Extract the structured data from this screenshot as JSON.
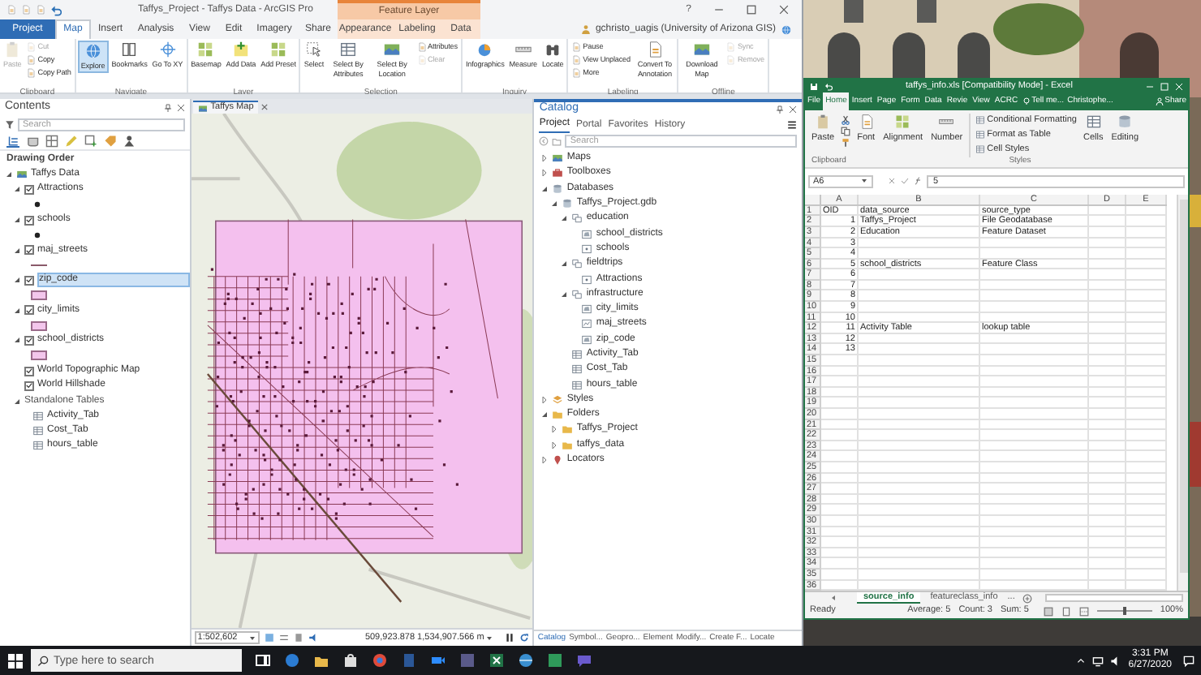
{
  "arcgis": {
    "title": "Taffys_Project - Taffys Data - ArcGIS Pro",
    "context_group": "Feature Layer",
    "help": "?",
    "tabs": [
      {
        "label": "Project",
        "kind": "backstage",
        "selected": false
      },
      {
        "label": "Map",
        "kind": "core",
        "selected": true
      },
      {
        "label": "Insert",
        "kind": "core",
        "selected": false
      },
      {
        "label": "Analysis",
        "kind": "core",
        "selected": false
      },
      {
        "label": "View",
        "kind": "core",
        "selected": false
      },
      {
        "label": "Edit",
        "kind": "core",
        "selected": false
      },
      {
        "label": "Imagery",
        "kind": "core",
        "selected": false
      },
      {
        "label": "Share",
        "kind": "core",
        "selected": false
      },
      {
        "label": "Appearance",
        "kind": "context",
        "selected": false
      },
      {
        "label": "Labeling",
        "kind": "context",
        "selected": false
      },
      {
        "label": "Data",
        "kind": "context",
        "selected": false
      }
    ],
    "user": "gchristo_uagis (University of Arizona GIS)",
    "ribbon": [
      {
        "label": "Clipboard",
        "tools": [
          {
            "label": "Paste",
            "kind": "large",
            "disabled": true,
            "selected": false
          },
          {
            "label": "Cut",
            "kind": "small",
            "disabled": true,
            "selected": false
          },
          {
            "label": "Copy",
            "kind": "small",
            "disabled": false,
            "selected": false
          },
          {
            "label": "Copy Path",
            "kind": "small",
            "disabled": false,
            "selected": false
          }
        ]
      },
      {
        "label": "Navigate",
        "tools": [
          {
            "label": "Explore",
            "kind": "large",
            "disabled": false,
            "selected": true
          },
          {
            "label": "Bookmarks",
            "kind": "large",
            "disabled": false,
            "selected": false
          },
          {
            "label": "Go To XY",
            "kind": "large",
            "disabled": false,
            "selected": false
          }
        ]
      },
      {
        "label": "Layer",
        "tools": [
          {
            "label": "Basemap",
            "kind": "large",
            "disabled": false,
            "selected": false
          },
          {
            "label": "Add Data",
            "kind": "large",
            "disabled": false,
            "selected": false
          },
          {
            "label": "Add Preset",
            "kind": "large",
            "disabled": false,
            "selected": false
          }
        ]
      },
      {
        "label": "Selection",
        "tools": [
          {
            "label": "Select",
            "kind": "large",
            "disabled": false,
            "selected": false
          },
          {
            "label": "Select By Attributes",
            "kind": "large",
            "disabled": false,
            "selected": false
          },
          {
            "label": "Select By Location",
            "kind": "large",
            "disabled": false,
            "selected": false
          },
          {
            "label": "Attributes",
            "kind": "small",
            "disabled": false,
            "selected": false
          },
          {
            "label": "Clear",
            "kind": "small",
            "disabled": true,
            "selected": false
          }
        ]
      },
      {
        "label": "Inquiry",
        "tools": [
          {
            "label": "Infographics",
            "kind": "large",
            "disabled": false,
            "selected": false
          },
          {
            "label": "Measure",
            "kind": "large",
            "disabled": false,
            "selected": false
          },
          {
            "label": "Locate",
            "kind": "large",
            "disabled": false,
            "selected": false
          }
        ]
      },
      {
        "label": "Labeling",
        "tools": [
          {
            "label": "Pause",
            "kind": "small",
            "disabled": false,
            "selected": false
          },
          {
            "label": "View Unplaced",
            "kind": "small",
            "disabled": false,
            "selected": false
          },
          {
            "label": "More",
            "kind": "small",
            "disabled": false,
            "selected": false
          },
          {
            "label": "Convert To Annotation",
            "kind": "large",
            "disabled": false,
            "selected": false
          }
        ]
      },
      {
        "label": "Offline",
        "tools": [
          {
            "label": "Download Map",
            "kind": "large",
            "disabled": false,
            "selected": false
          },
          {
            "label": "Sync",
            "kind": "small",
            "disabled": true,
            "selected": false
          },
          {
            "label": "Remove",
            "kind": "small",
            "disabled": true,
            "selected": false
          }
        ]
      }
    ],
    "contents": {
      "title": "Contents",
      "search_placeholder": "Search",
      "heading": "Drawing Order",
      "map": {
        "label": "Taffys Data",
        "expanded": true,
        "children": [
          {
            "label": "Attractions",
            "kind": "feature_layer",
            "checked": true,
            "expanded": true,
            "legend": {
              "kind": "point"
            },
            "selected": false
          },
          {
            "label": "schools",
            "kind": "feature_layer",
            "checked": true,
            "expanded": true,
            "legend": {
              "kind": "point"
            },
            "selected": false
          },
          {
            "label": "maj_streets",
            "kind": "feature_layer",
            "checked": true,
            "expanded": true,
            "legend": {
              "kind": "line"
            },
            "selected": false
          },
          {
            "label": "zip_code",
            "kind": "feature_layer",
            "checked": true,
            "expanded": true,
            "legend": {
              "kind": "polygon"
            },
            "selected": true
          },
          {
            "label": "city_limits",
            "kind": "feature_layer",
            "checked": true,
            "expanded": true,
            "legend": {
              "kind": "polygon"
            },
            "selected": false
          },
          {
            "label": "school_districts",
            "kind": "feature_layer",
            "checked": true,
            "expanded": true,
            "legend": {
              "kind": "polygon"
            },
            "selected": false
          },
          {
            "label": "World Topographic Map",
            "kind": "basemap_layer",
            "checked": true,
            "selected": false
          },
          {
            "label": "World Hillshade",
            "kind": "basemap_layer",
            "checked": true,
            "selected": false
          },
          {
            "label": "Standalone Tables",
            "kind": "table_group",
            "expanded": true,
            "children": [
              {
                "label": "Activity_Tab",
                "kind": "table"
              },
              {
                "label": "Cost_Tab",
                "kind": "table"
              },
              {
                "label": "hours_table",
                "kind": "table"
              }
            ]
          }
        ]
      }
    },
    "map_view": {
      "tab": "Taffys Map",
      "scale": "1:502,602",
      "coordinates": "509,923.878 1,534,907.566 m"
    },
    "catalog": {
      "title": "Catalog",
      "tabs": [
        {
          "label": "Project",
          "selected": true
        },
        {
          "label": "Portal",
          "selected": false
        },
        {
          "label": "Favorites",
          "selected": false
        },
        {
          "label": "History",
          "selected": false
        }
      ],
      "search_placeholder": "Search",
      "tree": [
        {
          "label": "Maps",
          "kind": "maps",
          "expanded": false
        },
        {
          "label": "Toolboxes",
          "kind": "toolboxes",
          "expanded": false
        },
        {
          "label": "Databases",
          "kind": "databases",
          "expanded": true,
          "children": [
            {
              "label": "Taffys_Project.gdb",
              "kind": "gdb",
              "expanded": true,
              "children": [
                {
                  "label": "education",
                  "kind": "dataset",
                  "expanded": true,
                  "children": [
                    {
                      "label": "school_districts",
                      "kind": "polygon_class"
                    },
                    {
                      "label": "schools",
                      "kind": "point_class"
                    }
                  ]
                },
                {
                  "label": "fieldtrips",
                  "kind": "dataset",
                  "expanded": true,
                  "children": [
                    {
                      "label": "Attractions",
                      "kind": "point_class"
                    }
                  ]
                },
                {
                  "label": "infrastructure",
                  "kind": "dataset",
                  "expanded": true,
                  "children": [
                    {
                      "label": "city_limits",
                      "kind": "polygon_class"
                    },
                    {
                      "label": "maj_streets",
                      "kind": "line_class"
                    },
                    {
                      "label": "zip_code",
                      "kind": "polygon_class"
                    }
                  ]
                },
                {
                  "label": "Activity_Tab",
                  "kind": "table"
                },
                {
                  "label": "Cost_Tab",
                  "kind": "table"
                },
                {
                  "label": "hours_table",
                  "kind": "table"
                }
              ]
            }
          ]
        },
        {
          "label": "Styles",
          "kind": "styles",
          "expanded": false
        },
        {
          "label": "Folders",
          "kind": "folders",
          "expanded": true,
          "children": [
            {
              "label": "Taffys_Project",
              "kind": "folder",
              "expanded": false
            },
            {
              "label": "taffys_data",
              "kind": "folder",
              "expanded": false
            }
          ]
        },
        {
          "label": "Locators",
          "kind": "locators",
          "expanded": false
        }
      ],
      "bottom_tabs": [
        {
          "label": "Catalog",
          "selected": true
        },
        {
          "label": "Symbol...",
          "selected": false
        },
        {
          "label": "Geopro...",
          "selected": false
        },
        {
          "label": "Element",
          "selected": false
        },
        {
          "label": "Modify...",
          "selected": false
        },
        {
          "label": "Create F...",
          "selected": false
        },
        {
          "label": "Locate",
          "selected": false
        }
      ]
    }
  },
  "excel": {
    "title": "taffys_info.xls [Compatibility Mode] - Excel",
    "tabs": [
      {
        "label": "File",
        "selected": false
      },
      {
        "label": "Home",
        "selected": true
      },
      {
        "label": "Insert",
        "selected": false
      },
      {
        "label": "Page",
        "selected": false
      },
      {
        "label": "Form",
        "selected": false
      },
      {
        "label": "Data",
        "selected": false
      },
      {
        "label": "Revie",
        "selected": false
      },
      {
        "label": "View",
        "selected": false
      },
      {
        "label": "ACRC",
        "selected": false
      }
    ],
    "tell_me": "Tell me...",
    "account": "Christophe...",
    "share": "Share",
    "ribbon": [
      {
        "kind": "large",
        "label": "Paste"
      },
      {
        "kind": "clip_icons"
      },
      {
        "kind": "large",
        "label": "Font"
      },
      {
        "kind": "large",
        "label": "Alignment"
      },
      {
        "kind": "large",
        "label": "Number"
      },
      {
        "kind": "list",
        "items": [
          "Conditional Formatting",
          "Format as Table",
          "Cell Styles"
        ]
      },
      {
        "kind": "large",
        "label": "Cells"
      },
      {
        "kind": "large",
        "label": "Editing"
      }
    ],
    "group_labels": [
      "Clipboard",
      "Styles"
    ],
    "name_box": "A6",
    "formula": "5",
    "columns": [
      "A",
      "B",
      "C",
      "D",
      "E"
    ],
    "rows": [
      {
        "number": "1",
        "kind": "header",
        "a": "OID",
        "b": "data_source",
        "c": "source_type"
      },
      {
        "number": "2",
        "kind": "record",
        "a": "1",
        "b": "Taffys_Project",
        "c": "File Geodatabase"
      },
      {
        "number": "3",
        "kind": "record",
        "a": "2",
        "b": "Education",
        "c": "Feature Dataset"
      },
      {
        "number": "4",
        "kind": "record",
        "a": "3"
      },
      {
        "number": "5",
        "kind": "record",
        "a": "4"
      },
      {
        "number": "6",
        "kind": "record",
        "a": "5",
        "b": "school_districts",
        "c": "Feature Class"
      },
      {
        "number": "7",
        "kind": "record",
        "a": "6"
      },
      {
        "number": "8",
        "kind": "record",
        "a": "7"
      },
      {
        "number": "9",
        "kind": "record",
        "a": "8"
      },
      {
        "number": "10",
        "kind": "record",
        "a": "9"
      },
      {
        "number": "11",
        "kind": "record",
        "a": "10"
      },
      {
        "number": "12",
        "kind": "record",
        "a": "11",
        "b": "Activity Table",
        "c": "lookup table"
      },
      {
        "number": "13",
        "kind": "record",
        "a": "12"
      },
      {
        "number": "14",
        "kind": "record",
        "a": "13"
      },
      {
        "number": "15"
      },
      {
        "number": "16"
      },
      {
        "number": "17"
      },
      {
        "number": "18"
      },
      {
        "number": "19"
      },
      {
        "number": "20"
      },
      {
        "number": "21"
      },
      {
        "number": "22"
      },
      {
        "number": "23"
      },
      {
        "number": "24"
      },
      {
        "number": "25"
      },
      {
        "number": "26"
      },
      {
        "number": "27"
      },
      {
        "number": "28"
      },
      {
        "number": "29"
      },
      {
        "number": "30"
      },
      {
        "number": "31"
      },
      {
        "number": "32"
      },
      {
        "number": "33"
      },
      {
        "number": "34"
      },
      {
        "number": "35"
      },
      {
        "number": "36"
      }
    ],
    "sheets": [
      {
        "label": "source_info",
        "selected": true
      },
      {
        "label": "featureclass_info",
        "selected": false
      }
    ],
    "more_sheets": "...",
    "status": {
      "mode": "Ready",
      "stats": [
        "Average: 5",
        "Count: 3",
        "Sum: 5"
      ],
      "zoom_slider": {
        "level": 0.5
      },
      "zoom": "100%"
    }
  },
  "taskbar": {
    "search_placeholder": "Type here to search",
    "time": "3:31 PM",
    "date": "6/27/2020"
  }
}
